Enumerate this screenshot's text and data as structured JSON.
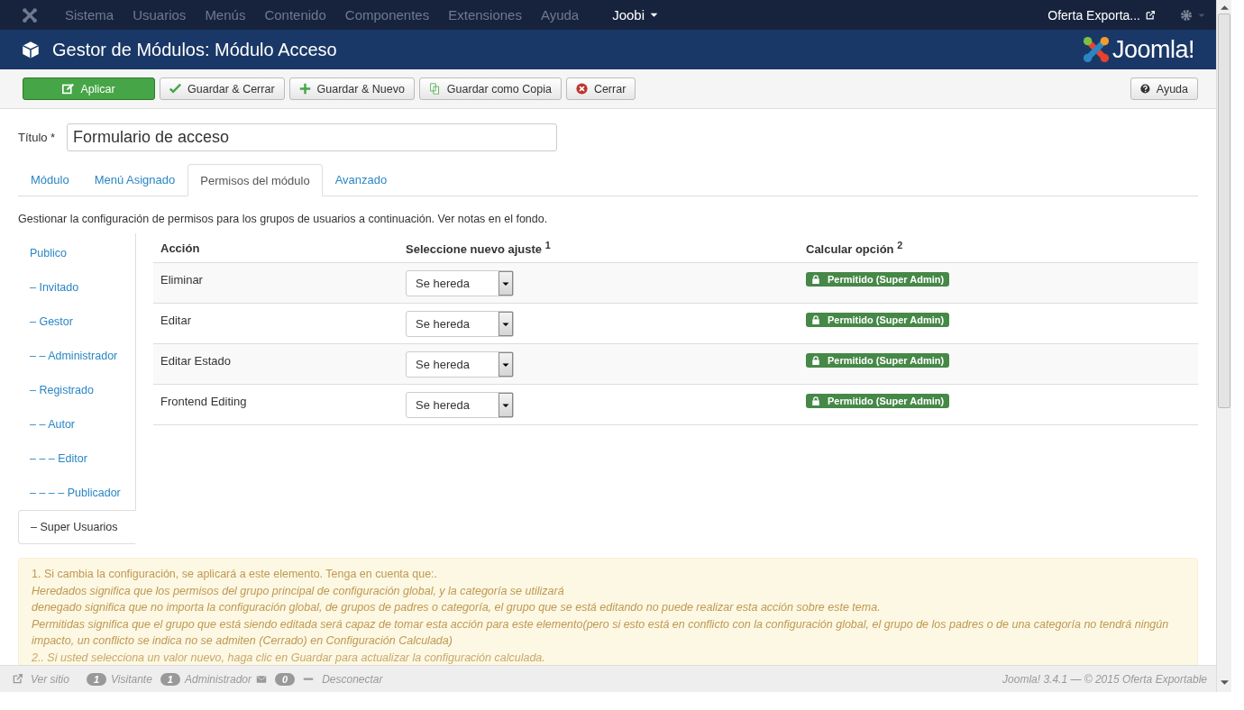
{
  "topbar": {
    "menu": [
      "Sistema",
      "Usuarios",
      "Menús",
      "Contenido",
      "Componentes",
      "Extensiones",
      "Ayuda"
    ],
    "user_menu": "Joobi",
    "site_link": "Oferta Exporta..."
  },
  "header": {
    "title": "Gestor de Módulos: Módulo Acceso",
    "logo_text": "Joomla!"
  },
  "toolbar": {
    "buttons": [
      {
        "label": "Aplicar",
        "kind": "apply"
      },
      {
        "label": "Guardar & Cerrar",
        "kind": "save-close"
      },
      {
        "label": "Guardar & Nuevo",
        "kind": "save-new"
      },
      {
        "label": "Guardar como Copia",
        "kind": "save-copy"
      },
      {
        "label": "Cerrar",
        "kind": "close"
      }
    ],
    "help": "Ayuda"
  },
  "form": {
    "title_label": "Título *",
    "title_value": "Formulario de acceso"
  },
  "tabs": [
    {
      "label": "Módulo",
      "selected": false
    },
    {
      "label": "Menú Asignado",
      "selected": false
    },
    {
      "label": "Permisos del módulo",
      "selected": true
    },
    {
      "label": "Avanzado",
      "selected": false
    }
  ],
  "intro": "Gestionar la configuración de permisos para los grupos de usuarios a continuación. Ver notas en el fondo.",
  "groups": [
    {
      "label": "Publico",
      "selected": false
    },
    {
      "label": "– Invitado",
      "selected": false
    },
    {
      "label": "– Gestor",
      "selected": false
    },
    {
      "label": "– – Administrador",
      "selected": false
    },
    {
      "label": "– Registrado",
      "selected": false
    },
    {
      "label": "– – Autor",
      "selected": false
    },
    {
      "label": "– – – Editor",
      "selected": false
    },
    {
      "label": "– – – – Publicador",
      "selected": false
    },
    {
      "label": "– Super Usuarios",
      "selected": true
    }
  ],
  "table": {
    "columns": [
      "Acción",
      "Seleccione nuevo ajuste $^{1}$",
      "Calcular opción $^{2}$"
    ],
    "rows": [
      {
        "action": "Eliminar",
        "setting": "Se hereda",
        "calculated": "Permitido (Super Admin)"
      },
      {
        "action": "Editar",
        "setting": "Se hereda",
        "calculated": "Permitido (Super Admin)"
      },
      {
        "action": "Editar Estado",
        "setting": "Se hereda",
        "calculated": "Permitido (Super Admin)"
      },
      {
        "action": "Frontend Editing",
        "setting": "Se hereda",
        "calculated": "Permitido (Super Admin)"
      }
    ]
  },
  "notes": [
    {
      "text": "1. Si cambia la configuración, se aplicará a este elemento. Tenga en cuenta que:.",
      "italic": false
    },
    {
      "text": "Heredados significa que los permisos del grupo principal de configuración global, y la categoría se utilizará",
      "italic": true
    },
    {
      "text": "denegado significa que no importa la configuración global, de grupos de padres o categoría, el grupo que se está editando no puede realizar esta acción sobre este tema.",
      "italic": true
    },
    {
      "text": "Permitidas significa que el grupo que está siendo editada será capaz de tomar esta acción para este elemento(pero si esto está en conflicto con la configuración global, el grupo de los padres o de una categoría no tendrá ningún impacto, un conflicto se indica no se admiten (Cerrado) en Configuración Calculada)",
      "italic": true
    },
    {
      "text": "2.. Si usted selecciona un valor nuevo, haga clic en Guardar para actualizar la configuración calculada.",
      "italic": true
    }
  ],
  "status_bar": {
    "view_site": "Ver sitio",
    "visitors_count": "1",
    "visitors": "Visitante",
    "admins_count": "1",
    "admins": "Administrador",
    "messages_count": "0",
    "logout": "Desconectar",
    "version": "Joomla! 3.4.1 — © 2015 Oferta Exportable"
  }
}
